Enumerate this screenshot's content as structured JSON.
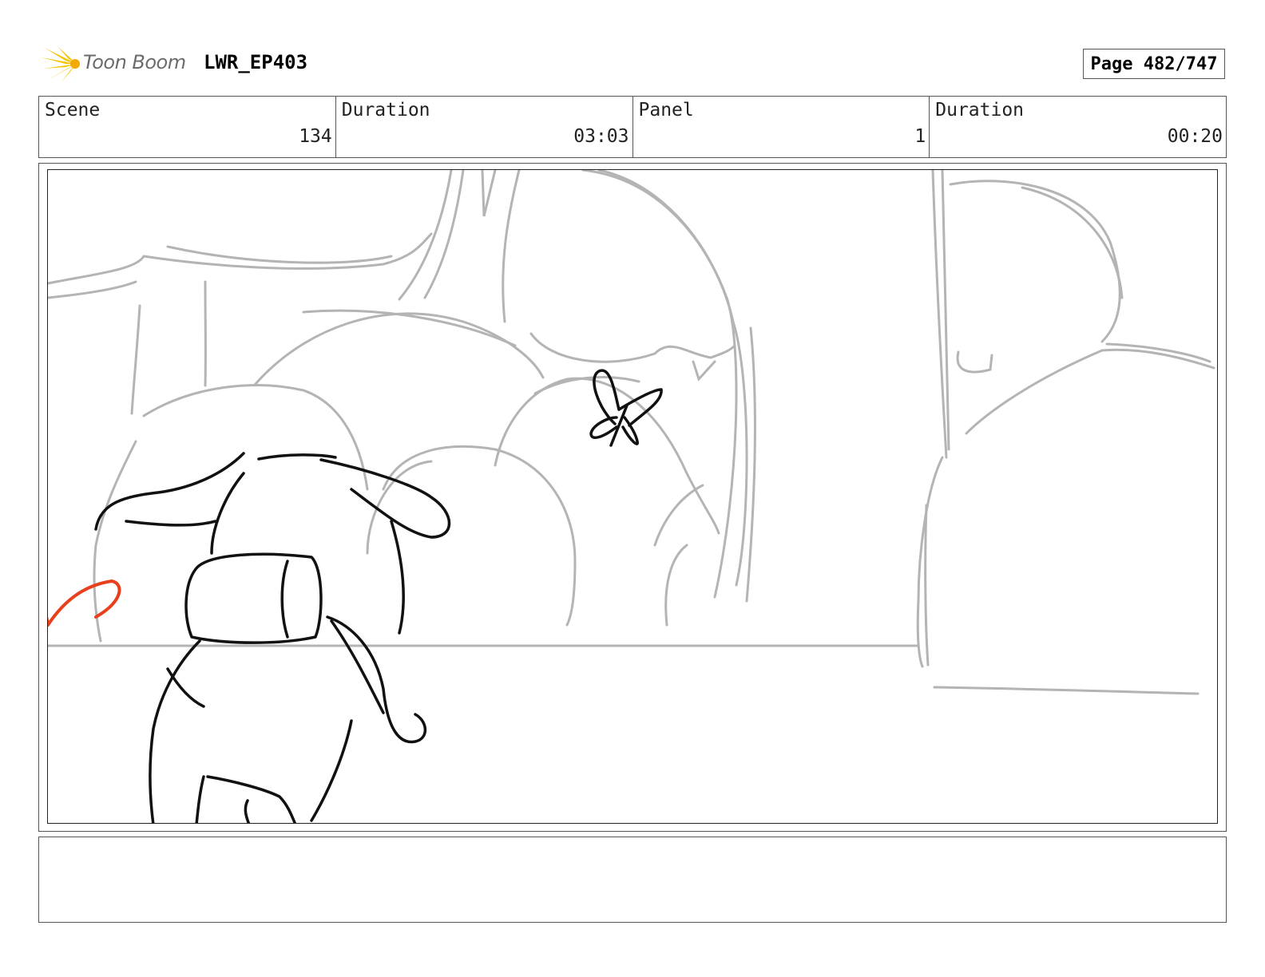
{
  "header": {
    "logo_text": "Toon Boom",
    "project_title": "LWR_EP403",
    "page_indicator": "Page 482/747"
  },
  "info": {
    "scene_label": "Scene",
    "scene_value": "134",
    "scene_duration_label": "Duration",
    "scene_duration_value": "03:03",
    "panel_label": "Panel",
    "panel_value": "1",
    "panel_duration_label": "Duration",
    "panel_duration_value": "00:20"
  },
  "panel": {
    "sketch_line_color": "#b4b4b4",
    "character_line_color": "#111111",
    "motion_arrow_color": "#e8401c"
  },
  "notes": {
    "text": ""
  }
}
